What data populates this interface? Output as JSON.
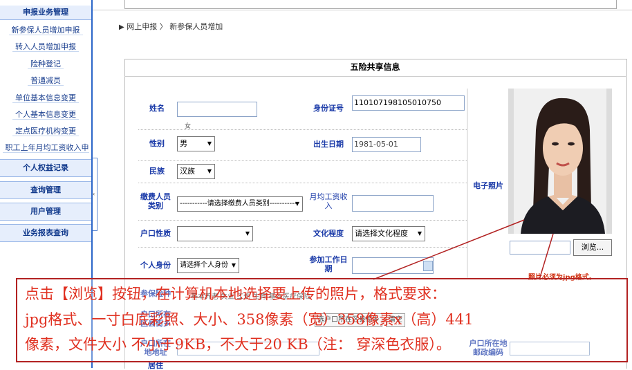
{
  "sidebar": {
    "top_section": "申报业务管理",
    "items": [
      "新参保人员增加申报",
      "转入人员增加申报",
      "险种登记",
      "普通减员",
      "单位基本信息变更",
      "个人基本信息变更",
      "定点医疗机构变更",
      "职工上年月均工资收入申报"
    ],
    "sections": [
      "个人权益记录",
      "查询管理",
      "用户管理",
      "业务报表查询"
    ]
  },
  "breadcrumb": {
    "root": "网上申报",
    "separator": "〉",
    "current": "新参保人员增加"
  },
  "form": {
    "title": "五险共享信息",
    "name_label": "姓名",
    "name_hint": "女",
    "id_label": "身份证号",
    "id_value": "110107198105010750",
    "gender_label": "性别",
    "gender_value": "男",
    "birth_label": "出生日期",
    "birth_value": "1981-05-01",
    "ethnic_label": "民族",
    "ethnic_value": "汉族",
    "payer_type_label": "缴费人员类别",
    "payer_type_value": "-----------请选择缴费人员类别-----------",
    "wage_label": "月均工资收入",
    "hukou_label": "户口性质",
    "edu_label": "文化程度",
    "edu_value": "请选择文化程度",
    "identity_label": "个人身份",
    "identity_value": "请选择个人身份",
    "work_date_label": "参加工作日期",
    "photo_label": "电子照片",
    "browse_button": "浏览...",
    "photo_note": "照片必须为jpg格式。",
    "insured_label": "参保险种",
    "insured_text": "基本养老 失业 工伤 生育 基本医疗保险",
    "hukou_addr_label": "户口所在区县街乡",
    "hukou_addr_btn1": "选户口所在区县街乡",
    "hukou_addr_btn2": "清空",
    "address_label": "户口所在地地址",
    "postcode_label": "户口所在地邮政编码",
    "more_label": "居住"
  },
  "annotation": {
    "line1": "点击【浏览】按钮，在计算机本地选择要上传的照片，格式要求：",
    "line2": "jpg格式、一寸白底彩照、大小、358像素（宽）358像素x（高）441",
    "line3": "像素，文件大小 不小于9KB，不大于20 KB（注： 穿深色衣服）。"
  }
}
